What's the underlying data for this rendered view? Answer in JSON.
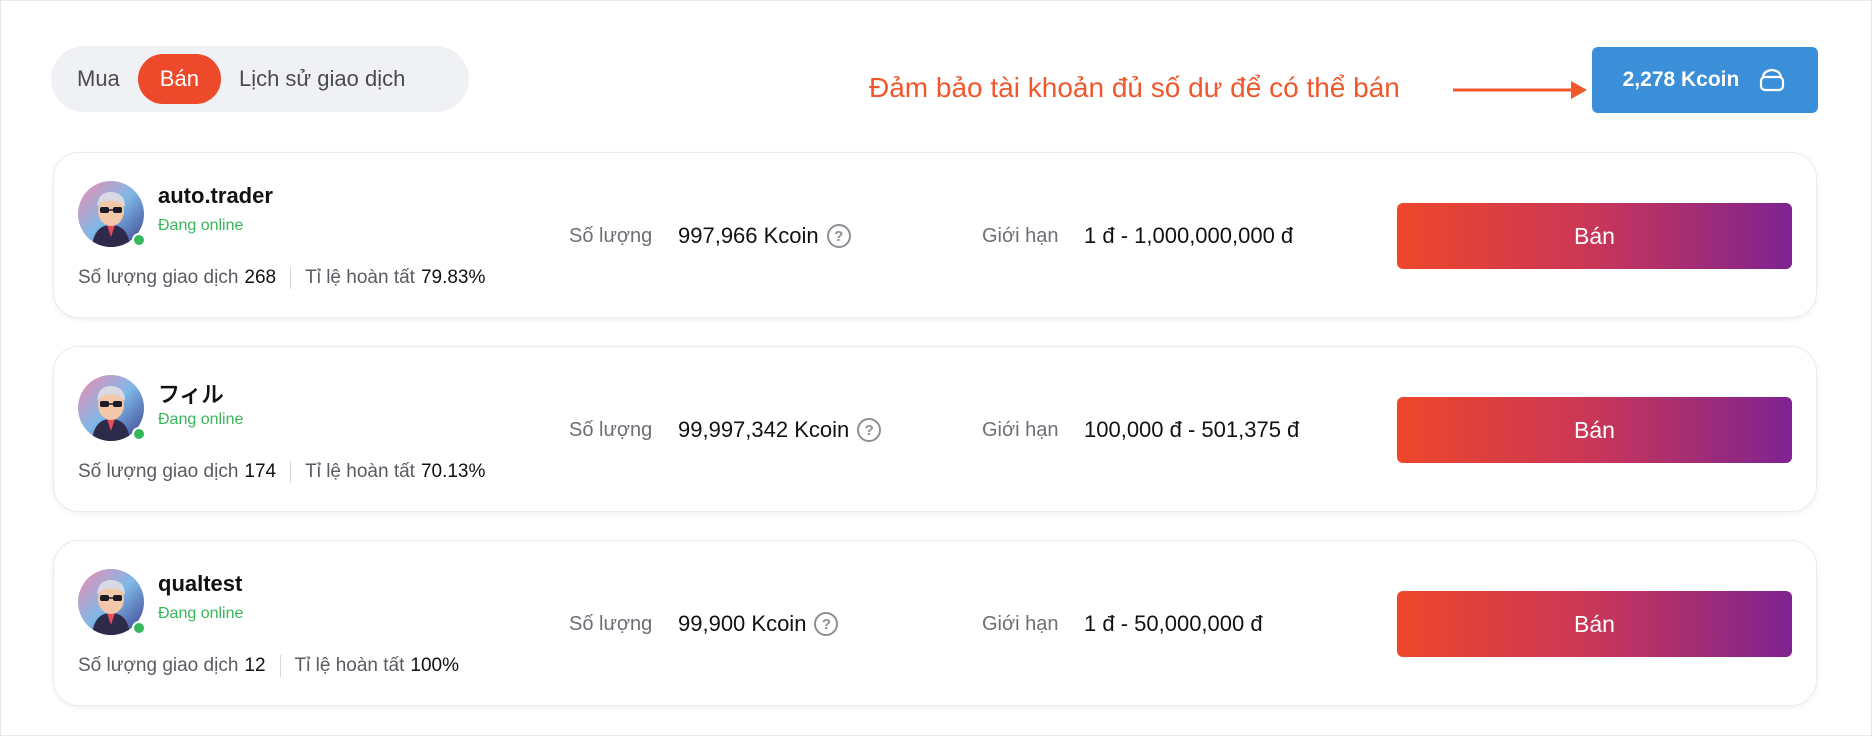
{
  "tabs": {
    "buy": "Mua",
    "sell": "Bán",
    "history": "Lịch sử giao dịch"
  },
  "annotation": "Đảm bảo tài khoản đủ số dư để có thể bán",
  "balance": {
    "label": "2,278 Kcoin",
    "icon": "wallet-icon"
  },
  "colors": {
    "accent": "#ec4a2b",
    "balance_button": "#3b8fd9",
    "online": "#35b859",
    "sell_gradient": [
      "#ee472a",
      "#c93658",
      "#7e2391"
    ],
    "annotation": "#f0572b"
  },
  "labels": {
    "status": "Đang online",
    "trades": "Số lượng giao dịch",
    "completion": "Tỉ lệ hoàn tất",
    "quantity": "Số lượng",
    "limit": "Giới hạn",
    "sell_button": "Bán",
    "help": "?"
  },
  "traders": [
    {
      "name": "auto.trader",
      "trades": "268",
      "completion": "79.83%",
      "quantity": "997,966 Kcoin",
      "limit": "1 đ - 1,000,000,000 đ"
    },
    {
      "name": "フィル",
      "trades": "174",
      "completion": "70.13%",
      "quantity": "99,997,342 Kcoin",
      "limit": "100,000 đ - 501,375 đ"
    },
    {
      "name": "qualtest",
      "trades": "12",
      "completion": "100%",
      "quantity": "99,900 Kcoin",
      "limit": "1 đ - 50,000,000 đ"
    }
  ]
}
